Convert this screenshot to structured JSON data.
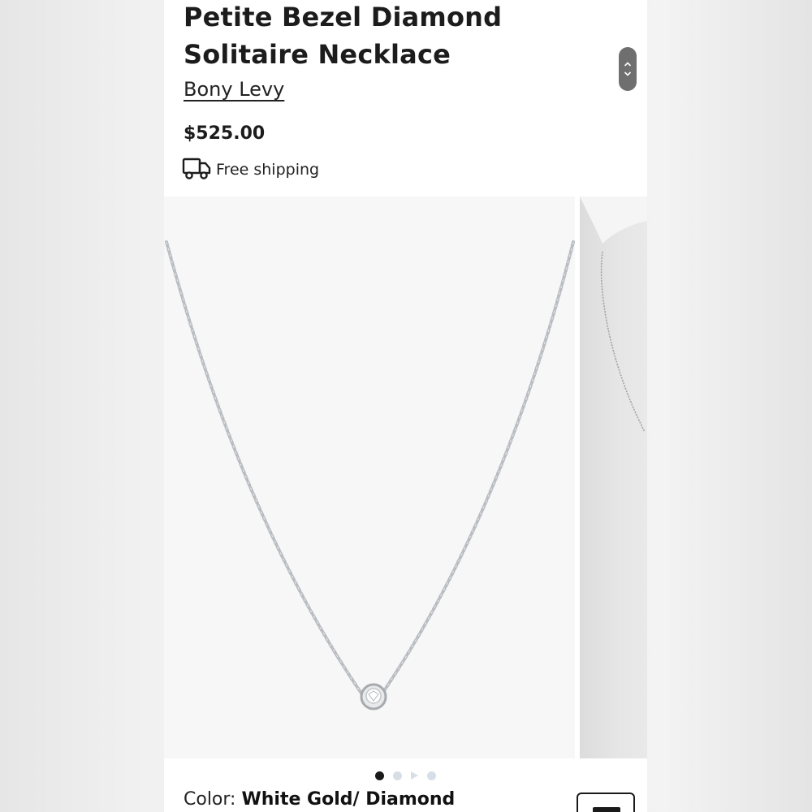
{
  "product": {
    "title": "Petite Bezel Diamond Solitaire Necklace",
    "brand": "Bony Levy",
    "price": "$525.00",
    "shipping": "Free shipping"
  },
  "gallery": {
    "slides_total": 4,
    "active_slide": 1,
    "slide_kinds": [
      "image",
      "image",
      "video",
      "image"
    ]
  },
  "color": {
    "label": "Color:",
    "value": "White Gold/ Diamond"
  },
  "icons": {
    "shipping": "truck-icon",
    "scroll_up": "chevron-up-icon",
    "scroll_down": "chevron-down-icon"
  },
  "colors": {
    "text": "#1c1c1c",
    "dot_active": "#1a1a1a",
    "dot_inactive": "#d7dee5",
    "scroll_control": "#6f6f6f"
  }
}
